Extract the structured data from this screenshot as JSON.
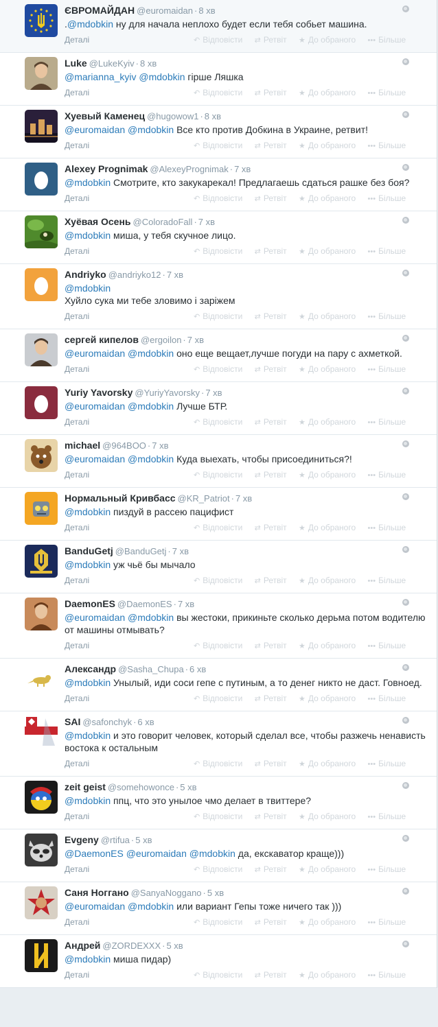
{
  "actions": {
    "details": "Деталі",
    "reply": "Відповісти",
    "retweet": "Ретвіт",
    "favorite": "До обраного",
    "more": "Більше"
  },
  "tweets": [
    {
      "name": "ЄВРОМАЙДАН",
      "handle": "@euromaidan",
      "time": "8 хв",
      "parts": [
        {
          "t": ".",
          "m": false
        },
        {
          "t": "@mdobkin",
          "m": true
        },
        {
          "t": " ну для начала неплохо будет если тебя собьет машина.",
          "m": false
        }
      ],
      "avatar": {
        "kind": "eu",
        "bg": "#1f4aa0",
        "fg": "#f2cc1e"
      }
    },
    {
      "name": "Luke",
      "handle": "@LukeKyiv",
      "time": "8 хв",
      "parts": [
        {
          "t": "@marianna_kyiv",
          "m": true
        },
        {
          "t": " ",
          "m": false
        },
        {
          "t": "@mdobkin",
          "m": true
        },
        {
          "t": " гірше Ляшка",
          "m": false
        }
      ],
      "avatar": {
        "kind": "portrait",
        "bg": "#b9ab8c",
        "fg": "#5b4530"
      }
    },
    {
      "name": "Хуевый Каменец",
      "handle": "@hugowow1",
      "time": "8 хв",
      "parts": [
        {
          "t": "@euromaidan",
          "m": true
        },
        {
          "t": " ",
          "m": false
        },
        {
          "t": "@mdobkin",
          "m": true
        },
        {
          "t": " Все кто против Добкина в Украине, ретвит!",
          "m": false
        }
      ],
      "avatar": {
        "kind": "castle",
        "bg": "#2a1f3a",
        "fg": "#d9a35a"
      }
    },
    {
      "name": "Alexey Prognimak",
      "handle": "@AlexeyPrognimak",
      "time": "7 хв",
      "parts": [
        {
          "t": "@mdobkin",
          "m": true
        },
        {
          "t": " Смотрите, кто закукарекал! Предлагаешь сдаться рашке без боя?",
          "m": false
        }
      ],
      "avatar": {
        "kind": "egg",
        "bg": "#2f5f86",
        "fg": "#ffffff"
      }
    },
    {
      "name": "Хуёвая Осень",
      "handle": "@ColoradoFall",
      "time": "7 хв",
      "parts": [
        {
          "t": "@mdobkin",
          "m": true
        },
        {
          "t": " миша, у тебя скучное лицо.",
          "m": false
        }
      ],
      "avatar": {
        "kind": "nature",
        "bg": "#4f8a2c",
        "fg": "#2a4a12"
      }
    },
    {
      "name": "Andriyko",
      "handle": "@andriyko12",
      "time": "7 хв",
      "parts": [
        {
          "t": "@mdobkin",
          "m": true
        },
        {
          "t": "\nХуйло сука ми тебе зловимо і заріжем",
          "m": false
        }
      ],
      "avatar": {
        "kind": "egg",
        "bg": "#f2a23c",
        "fg": "#ffffff"
      }
    },
    {
      "name": "сергей кипелов",
      "handle": "@ergoilon",
      "time": "7 хв",
      "parts": [
        {
          "t": "@euromaidan",
          "m": true
        },
        {
          "t": " ",
          "m": false
        },
        {
          "t": "@mdobkin",
          "m": true
        },
        {
          "t": " оно еще вещает,лучше погуди на пару с ахметкой.",
          "m": false
        }
      ],
      "avatar": {
        "kind": "portrait",
        "bg": "#c9ccd0",
        "fg": "#4a3a2c"
      }
    },
    {
      "name": "Yuriy Yavorsky",
      "handle": "@YuriyYavorsky",
      "time": "7 хв",
      "parts": [
        {
          "t": "@euromaidan",
          "m": true
        },
        {
          "t": " ",
          "m": false
        },
        {
          "t": "@mdobkin",
          "m": true
        },
        {
          "t": " Лучше БТР.",
          "m": false
        }
      ],
      "avatar": {
        "kind": "egg",
        "bg": "#8a2c3e",
        "fg": "#ffffff"
      }
    },
    {
      "name": "michael",
      "handle": "@964BOO",
      "time": "7 хв",
      "parts": [
        {
          "t": "@euromaidan",
          "m": true
        },
        {
          "t": " ",
          "m": false
        },
        {
          "t": "@mdobkin",
          "m": true
        },
        {
          "t": " Куда выехать, чтобы присоединиться?!",
          "m": false
        }
      ],
      "avatar": {
        "kind": "cartoon",
        "bg": "#e8d4a8",
        "fg": "#8a5a2a"
      }
    },
    {
      "name": "Нормальный Кривбасс",
      "handle": "@KR_Patriot",
      "time": "7 хв",
      "parts": [
        {
          "t": "@mdobkin",
          "m": true
        },
        {
          "t": " пиздуй в рассею пацифист",
          "m": false
        }
      ],
      "avatar": {
        "kind": "robot",
        "bg": "#f4a623",
        "fg": "#7a8a9a"
      }
    },
    {
      "name": "BanduGetj",
      "handle": "@BanduGetj",
      "time": "7 хв",
      "parts": [
        {
          "t": "@mdobkin",
          "m": true
        },
        {
          "t": " уж чьё бы мычало",
          "m": false
        }
      ],
      "avatar": {
        "kind": "emblem",
        "bg": "#1b2a5a",
        "fg": "#e6c03a"
      }
    },
    {
      "name": "DaemonES",
      "handle": "@DaemonES",
      "time": "7 хв",
      "parts": [
        {
          "t": "@euromaidan",
          "m": true
        },
        {
          "t": " ",
          "m": false
        },
        {
          "t": "@mdobkin",
          "m": true
        },
        {
          "t": " вы жестоки, прикиньте сколько дерьма потом водителю от машины отмывать?",
          "m": false
        }
      ],
      "avatar": {
        "kind": "portrait",
        "bg": "#c88a5a",
        "fg": "#6a3a1a"
      }
    },
    {
      "name": "Александр",
      "handle": "@Sasha_Chupa",
      "time": "6 хв",
      "parts": [
        {
          "t": "@mdobkin",
          "m": true
        },
        {
          "t": " Унылый, иди соси гепе с путиным, а то денег никто не даст. Говноед.",
          "m": false
        }
      ],
      "avatar": {
        "kind": "lizard",
        "bg": "#ffffff",
        "fg": "#d8b84a"
      }
    },
    {
      "name": "SAI",
      "handle": "@safonchyk",
      "time": "6 хв",
      "parts": [
        {
          "t": "@mdobkin",
          "m": true
        },
        {
          "t": " и это говорит человек, который сделал все, чтобы разжечь ненависть востока к остальным",
          "m": false
        }
      ],
      "avatar": {
        "kind": "flag",
        "bg": "#ffffff",
        "fg": "#c8262e"
      }
    },
    {
      "name": "zeit geist",
      "handle": "@somehowonce",
      "time": "5 хв",
      "parts": [
        {
          "t": "@mdobkin",
          "m": true
        },
        {
          "t": " ппц, что это унылое чмо делает в твиттере?",
          "m": false
        }
      ],
      "avatar": {
        "kind": "ball",
        "bg": "#1a1a1a",
        "fg": "#2f6fd0"
      }
    },
    {
      "name": "Evgeny",
      "handle": "@rtifua",
      "time": "5 хв",
      "parts": [
        {
          "t": "@DaemonES",
          "m": true
        },
        {
          "t": " ",
          "m": false
        },
        {
          "t": "@euromaidan",
          "m": true
        },
        {
          "t": " ",
          "m": false
        },
        {
          "t": "@mdobkin",
          "m": true
        },
        {
          "t": " да, екскаватор краще)))",
          "m": false
        }
      ],
      "avatar": {
        "kind": "raccoon",
        "bg": "#3a3a3a",
        "fg": "#d8d8d8"
      }
    },
    {
      "name": "Саня Ноггано",
      "handle": "@SanyaNoggano",
      "time": "5 хв",
      "parts": [
        {
          "t": "@euromaidan",
          "m": true
        },
        {
          "t": " ",
          "m": false
        },
        {
          "t": "@mdobkin",
          "m": true
        },
        {
          "t": " или вариант Гепы тоже ничего так )))",
          "m": false
        }
      ],
      "avatar": {
        "kind": "star",
        "bg": "#d8d0c4",
        "fg": "#c0242a"
      }
    },
    {
      "name": "Андрей",
      "handle": "@ZORDEXXX",
      "time": "5 хв",
      "parts": [
        {
          "t": "@mdobkin",
          "m": true
        },
        {
          "t": " миша пидар)",
          "m": false
        }
      ],
      "avatar": {
        "kind": "rune",
        "bg": "#1a1a1a",
        "fg": "#f0c020"
      }
    }
  ]
}
